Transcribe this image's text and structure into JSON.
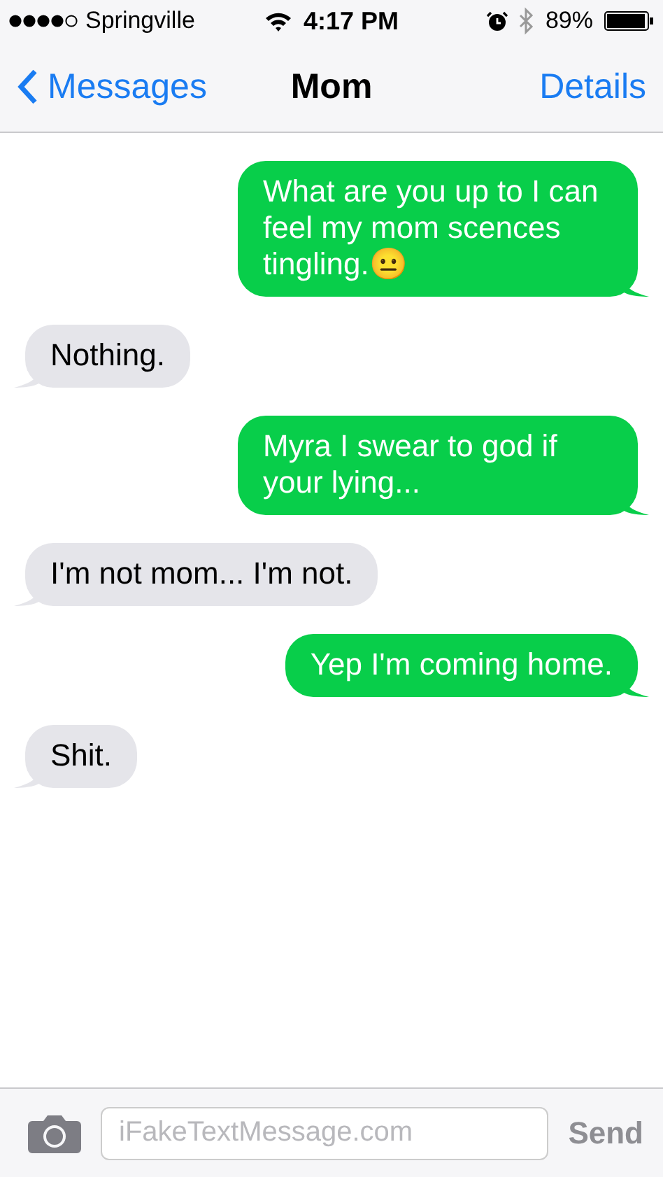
{
  "status_bar": {
    "carrier": "Springville",
    "time": "4:17 PM",
    "battery": "89%"
  },
  "nav": {
    "back": "Messages",
    "title": "Mom",
    "action": "Details"
  },
  "messages": [
    {
      "kind": "sent",
      "text": "What are you up to I can feel my mom scences tingling.😐"
    },
    {
      "kind": "received",
      "text": "Nothing."
    },
    {
      "kind": "sent",
      "text": "Myra I swear to god if your lying..."
    },
    {
      "kind": "received",
      "text": "I'm not mom... I'm not."
    },
    {
      "kind": "sent",
      "text": "Yep I'm coming home."
    },
    {
      "kind": "received",
      "text": "Shit."
    }
  ],
  "compose": {
    "placeholder": "iFakeTextMessage.com",
    "send": "Send",
    "send_disabled": true
  }
}
